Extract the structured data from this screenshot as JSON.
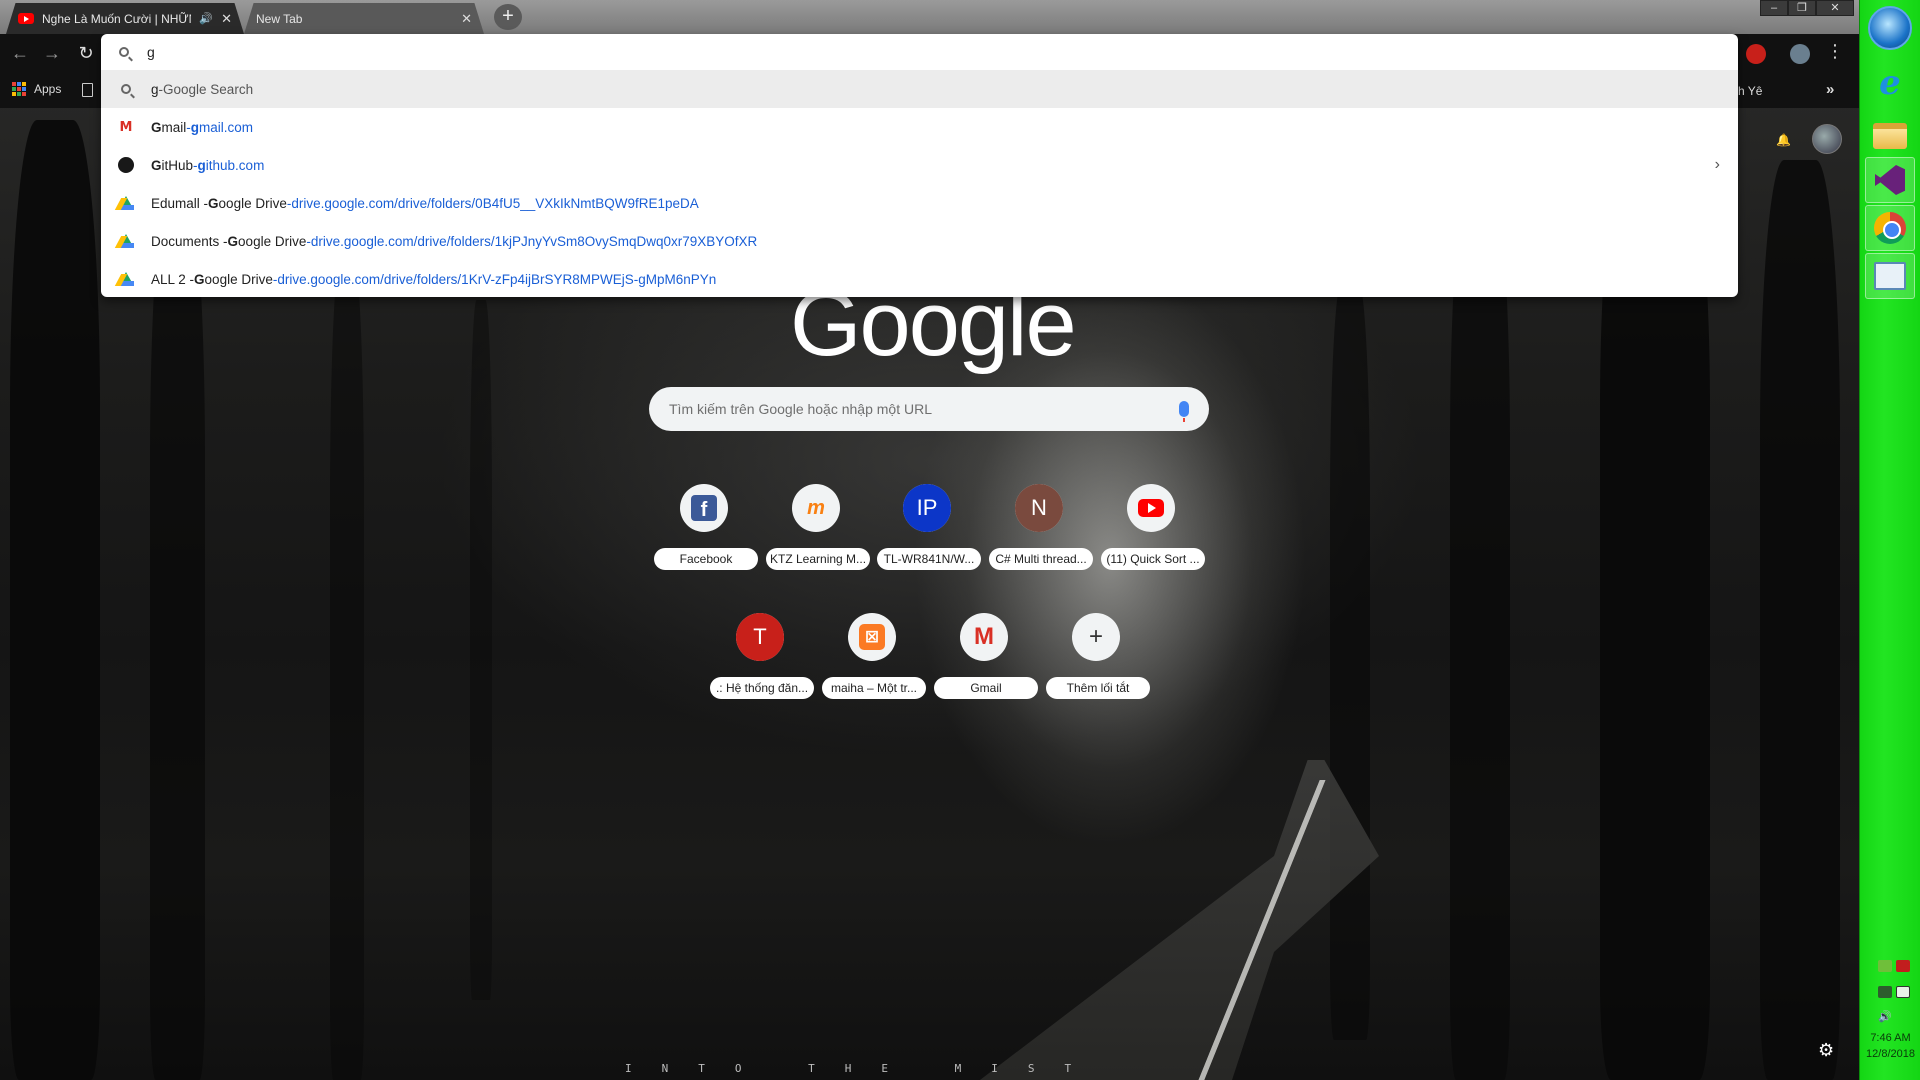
{
  "tabs": [
    {
      "title": "Nghe Là Muốn Cười | NHỮN",
      "active": true,
      "favicon": "youtube-icon",
      "audio": true
    },
    {
      "title": "New Tab",
      "active": false
    }
  ],
  "omnibox": {
    "value": "g",
    "suggestions": [
      {
        "icon": "search-icon",
        "title": "g",
        "separator": " - ",
        "url": "Google Search",
        "url_is_link": false
      },
      {
        "icon": "gmail-icon",
        "title_bold": "G",
        "title_rest": "mail",
        "separator": " - ",
        "url_bold": "g",
        "url_rest": "mail.com"
      },
      {
        "icon": "github-icon",
        "title_bold": "G",
        "title_rest": "itHub",
        "separator": " - ",
        "url_bold": "g",
        "url_rest": "ithub.com"
      },
      {
        "icon": "google-drive-icon",
        "title_pre": "Edumall - ",
        "title_bold": "G",
        "title_rest": "oogle Drive",
        "separator": " - ",
        "url": "drive.google.com/drive/folders/0B4fU5__VXkIkNmtBQW9fRE1peDA"
      },
      {
        "icon": "google-drive-icon",
        "title_pre": "Documents - ",
        "title_bold": "G",
        "title_rest": "oogle Drive",
        "separator": " - ",
        "url": "drive.google.com/drive/folders/1kjPJnyYvSm8OvySmqDwq0xr79XBYOfXR"
      },
      {
        "icon": "google-drive-icon",
        "title_pre": "ALL 2 - ",
        "title_bold": "G",
        "title_rest": "oogle Drive",
        "separator": " - ",
        "url": "drive.google.com/drive/folders/1KrV-zFp4ijBrSYR8MPWEjS-gMpM6nPYn"
      }
    ]
  },
  "bookmarks": {
    "apps_label": "Apps",
    "truncated_label": "h Yê"
  },
  "ntp": {
    "logo": "Google",
    "search_placeholder": "Tìm kiếm trên Google hoặc nhập một URL",
    "shortcuts_row1": [
      {
        "label": "Facebook",
        "icon": "facebook-icon"
      },
      {
        "label": "KTZ Learning M...",
        "icon": "moodle-icon"
      },
      {
        "label": "TL-WR841N/W...",
        "letter": "IP",
        "color": "#0c36c8"
      },
      {
        "label": "C# Multi thread...",
        "letter": "N",
        "color": "#7a4a3e"
      },
      {
        "label": "(11) Quick Sort ...",
        "icon": "youtube-icon"
      }
    ],
    "shortcuts_row2": [
      {
        "label": ".: Hệ thống đăn...",
        "letter": "T",
        "color": "#c8201a"
      },
      {
        "label": "maiha – Một tr...",
        "icon": "xampp-icon"
      },
      {
        "label": "Gmail",
        "icon": "gmail-icon"
      },
      {
        "label": "Thêm lối tắt",
        "icon": "plus-icon"
      }
    ],
    "footer_text": "INTO THE MIST"
  },
  "taskbar": {
    "time": "7:46 AM",
    "date": "12/8/2018",
    "accent": "#1ed41e"
  }
}
